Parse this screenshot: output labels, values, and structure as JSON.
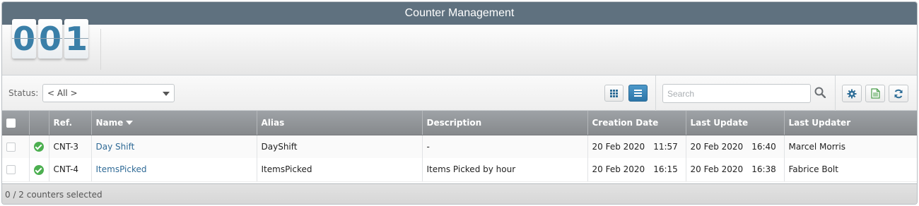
{
  "window": {
    "title": "Counter Management"
  },
  "counter": {
    "digits": [
      "0",
      "0",
      "1"
    ]
  },
  "toolbar": {
    "status_label": "Status:",
    "status_value": "< All >",
    "search_placeholder": "Search"
  },
  "table": {
    "headers": [
      "",
      "",
      "Ref.",
      "Name",
      "Alias",
      "Description",
      "Creation Date",
      "Last Update",
      "Last Updater"
    ],
    "rows": [
      {
        "ref": "CNT-3",
        "name": "Day Shift",
        "alias": "DayShift",
        "description": "-",
        "creation_date": "20 Feb 2020",
        "creation_time": "11:57",
        "last_update_date": "20 Feb 2020",
        "last_update_time": "16:40",
        "last_updater": "Marcel Morris"
      },
      {
        "ref": "CNT-4",
        "name": "ItemsPicked",
        "alias": "ItemsPicked",
        "description": "Items Picked by hour",
        "creation_date": "20 Feb 2020",
        "creation_time": "16:15",
        "last_update_date": "20 Feb 2020",
        "last_update_time": "16:38",
        "last_updater": "Fabrice Bolt"
      }
    ]
  },
  "footer": {
    "selection_text": "0 / 2 counters selected"
  },
  "colors": {
    "titlebar": "#5f717f",
    "accent": "#2d76a8",
    "link": "#2f6a96",
    "status_ok": "#4caf50"
  }
}
